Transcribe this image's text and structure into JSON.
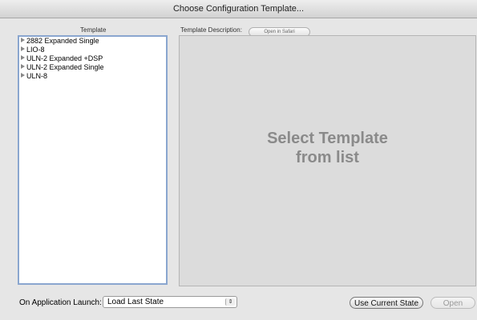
{
  "window": {
    "title": "Choose Configuration Template..."
  },
  "template_list": {
    "header": "Template",
    "items": [
      {
        "label": "2882 Expanded Single"
      },
      {
        "label": "LIO-8"
      },
      {
        "label": "ULN-2 Expanded +DSP"
      },
      {
        "label": "ULN-2 Expanded Single"
      },
      {
        "label": "ULN-8"
      }
    ]
  },
  "description": {
    "header": "Template Description:",
    "open_in_safari_label": "Open in Safari",
    "placeholder_line1": "Select Template",
    "placeholder_line2": "from list"
  },
  "footer": {
    "launch_label": "On Application Launch:",
    "launch_value": "Load Last State",
    "use_current_state_label": "Use Current State",
    "open_label": "Open"
  },
  "icons": {
    "disclosure": "disclosure-triangle-icon",
    "popup": "updown-arrows-icon"
  }
}
